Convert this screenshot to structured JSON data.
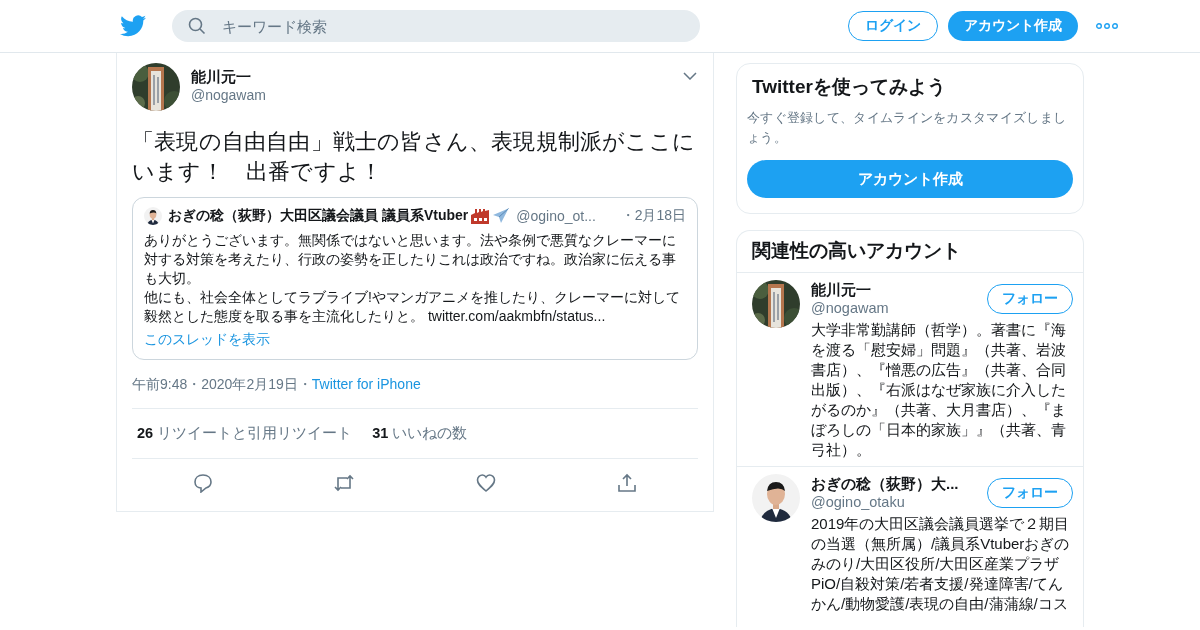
{
  "header": {
    "search_placeholder": "キーワード検索",
    "login_button": "ログイン",
    "signup_button": "アカウント作成"
  },
  "tweet": {
    "author": {
      "name": "能川元一",
      "handle": "@nogawam"
    },
    "text": "「表現の自由自由」戦士の皆さん、表現規制派がここにいます！　出番ですよ！",
    "quote": {
      "name": "おぎの稔（荻野）大田区議会議員 議員系Vtuber",
      "badges": [
        {
          "kind": "factory"
        },
        {
          "kind": "airplane"
        }
      ],
      "handle": "@ogino_ot...",
      "date": "・2月18日",
      "paragraphs": [
        "ありがとうございます。無関係ではないと思います。法や条例で悪質なクレーマーに対する対策を考えたり、行政の姿勢を正したりこれは政治ですね。政治家に伝える事も大切。",
        "他にも、社会全体としてラブライブ!やマンガアニメを推したり、クレーマーに対して毅然とした態度を取る事を主流化したりと。 "
      ],
      "link": "twitter.com/aakmbfn/status...",
      "show_thread": "このスレッドを表示"
    },
    "timestamp": "午前9:48・2020年2月19日・",
    "source": "Twitter for iPhone",
    "stats": [
      {
        "count": "26",
        "label": "リツイートと引用リツイート"
      },
      {
        "count": "31",
        "label": "いいねの数"
      }
    ],
    "actions": [
      {
        "kind": "reply"
      },
      {
        "kind": "retweet"
      },
      {
        "kind": "like"
      },
      {
        "kind": "share"
      }
    ]
  },
  "signup_card": {
    "title": "Twitterを使ってみよう",
    "description": "今すぐ登録して、タイムラインをカスタマイズしましょう。",
    "button": "アカウント作成"
  },
  "related": {
    "title": "関連性の高いアカウント",
    "accounts": [
      {
        "name": "能川元一",
        "handle": "@nogawam",
        "follow_button": "フォロー",
        "bio": "大学非常勤講師（哲学）。著書に『海を渡る「慰安婦」問題』（共著、岩波書店）、『憎悪の広告』（共著、合同出版）、『右派はなぜ家族に介入したがるのか』（共著、大月書店）、『まぼろしの「日本的家族」』（共著、青弓社）。"
      },
      {
        "name": "おぎの稔（荻野）大...",
        "handle": "@ogino_otaku",
        "follow_button": "フォロー",
        "bio": "2019年の大田区議会議員選挙で２期目の当選（無所属）/議員系Vtuberおぎのみのり/大田区役所/大田区産業プラザPiO/自殺対策/若者支援/発達障害/てんかん/動物愛護/表現の自由/蒲蒲線/コス"
      }
    ]
  }
}
